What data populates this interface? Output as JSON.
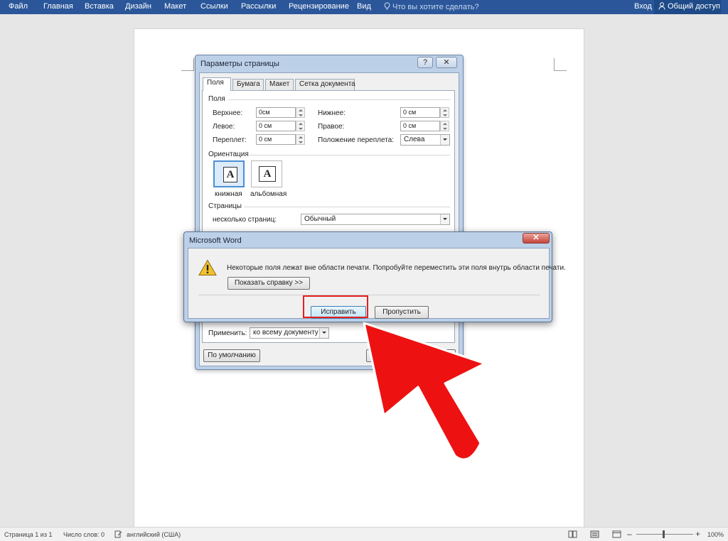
{
  "ribbon": {
    "tabs": [
      "Файл",
      "Главная",
      "Вставка",
      "Дизайн",
      "Макет",
      "Ссылки",
      "Рассылки",
      "Рецензирование",
      "Вид"
    ],
    "tell_me": "Что вы хотите сделать?",
    "signin": "Вход",
    "share": "Общий доступ"
  },
  "page_setup": {
    "title": "Параметры страницы",
    "help_btn": "?",
    "close_btn": "✕",
    "tabs": [
      "Поля",
      "Бумага",
      "Макет",
      "Сетка документа"
    ],
    "margins_group": "Поля",
    "top_label": "Верхнее:",
    "top_value": "0см",
    "left_label": "Левое:",
    "left_value": "0 см",
    "gutter_label": "Переплет:",
    "gutter_value": "0 см",
    "bottom_label": "Нижнее:",
    "bottom_value": "0 см",
    "right_label": "Правое:",
    "right_value": "0 см",
    "gutter_pos_label": "Положение переплета:",
    "gutter_pos_value": "Слева",
    "orientation_group": "Ориентация",
    "portrait_label": "книжная",
    "landscape_label": "альбомная",
    "orientation_glyph": "A",
    "pages_group": "Страницы",
    "multiple_pages_label": "несколько страниц:",
    "multiple_pages_value": "Обычный",
    "apply_label": "Применить:",
    "apply_value": "ко всему документу",
    "default_btn": "По умолчанию"
  },
  "message": {
    "title": "Microsoft Word",
    "close": "✕",
    "text": "Некоторые поля лежат вне области печати. Попробуйте переместить эти поля внутрь области печати.",
    "help_btn": "Показать справку >>",
    "fix_btn": "Исправить",
    "ignore_btn": "Пропустить"
  },
  "status": {
    "page": "Страница 1 из 1",
    "words": "Число слов: 0",
    "language": "английский (США)",
    "zoom": "100%",
    "zoom_minus": "–",
    "zoom_plus": "+"
  },
  "colors": {
    "ribbon": "#2b579a",
    "arrow": "#ee1111",
    "highlight": "#e52020"
  }
}
